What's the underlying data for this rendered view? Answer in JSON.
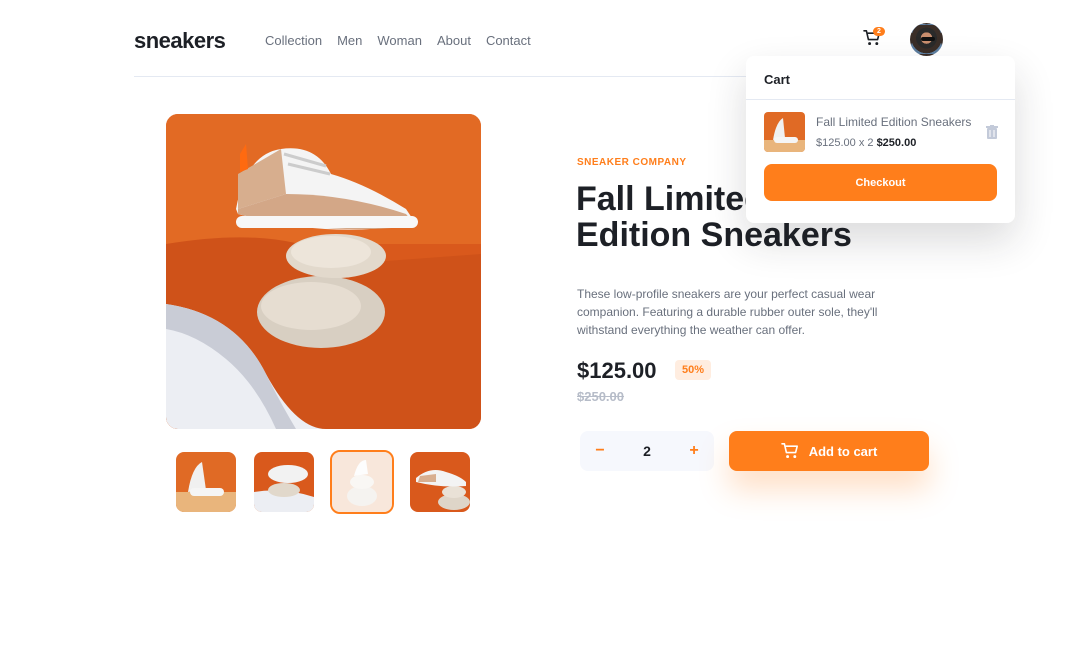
{
  "brand": {
    "logo": "sneakers"
  },
  "nav": {
    "items": [
      "Collection",
      "Men",
      "Woman",
      "About",
      "Contact"
    ]
  },
  "header": {
    "cart_count": "2",
    "cart_icon": "cart-icon",
    "avatar_icon": "avatar"
  },
  "product": {
    "company": "SNEAKER COMPANY",
    "title": "Fall Limited Edition Sneakers",
    "description": "These low-profile sneakers are your perfect casual wear companion. Featuring a durable rubber outer sole, they'll withstand everything the weather can offer.",
    "price": "$125.00",
    "discount": "50%",
    "old_price": "$250.00",
    "quantity": "2",
    "minus": "−",
    "plus": "+",
    "add_to_cart": "Add to cart",
    "active_thumbnail": 3
  },
  "cart": {
    "title": "Cart",
    "item_name": "Fall Limited Edition Sneakers",
    "item_calc": "$125.00 x 2",
    "item_total": "$250.00",
    "checkout": "Checkout"
  },
  "colors": {
    "accent": "#ff7e1b",
    "accent_light": "#ffede0",
    "dark": "#1d2026",
    "gray": "#69707d"
  }
}
